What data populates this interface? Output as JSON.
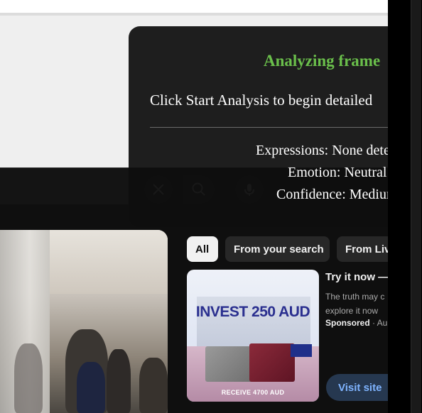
{
  "overlay": {
    "title": "Analyzing frame",
    "message": "Click Start Analysis to begin detailed",
    "expressions": "Expressions: None detected",
    "emotion": "Emotion: Neutral",
    "confidence": "Confidence: Medium",
    "title_color": "#6abf4b"
  },
  "chips": [
    {
      "label": "All"
    },
    {
      "label": "From your search"
    },
    {
      "label": "From Live"
    }
  ],
  "ad": {
    "thumb_headline": "INVEST 250 AUD",
    "thumb_footer": "RECEIVE 4700 AUD",
    "title": "Try it now —",
    "description": "The truth may c explore it now",
    "sponsored": "Sponsored",
    "sponsored_rest": " · Au",
    "cta": "Visit site",
    "cta_color": "#7fb4ff"
  },
  "icons": {
    "close": "close-icon",
    "search": "search-icon",
    "mic": "mic-icon"
  }
}
